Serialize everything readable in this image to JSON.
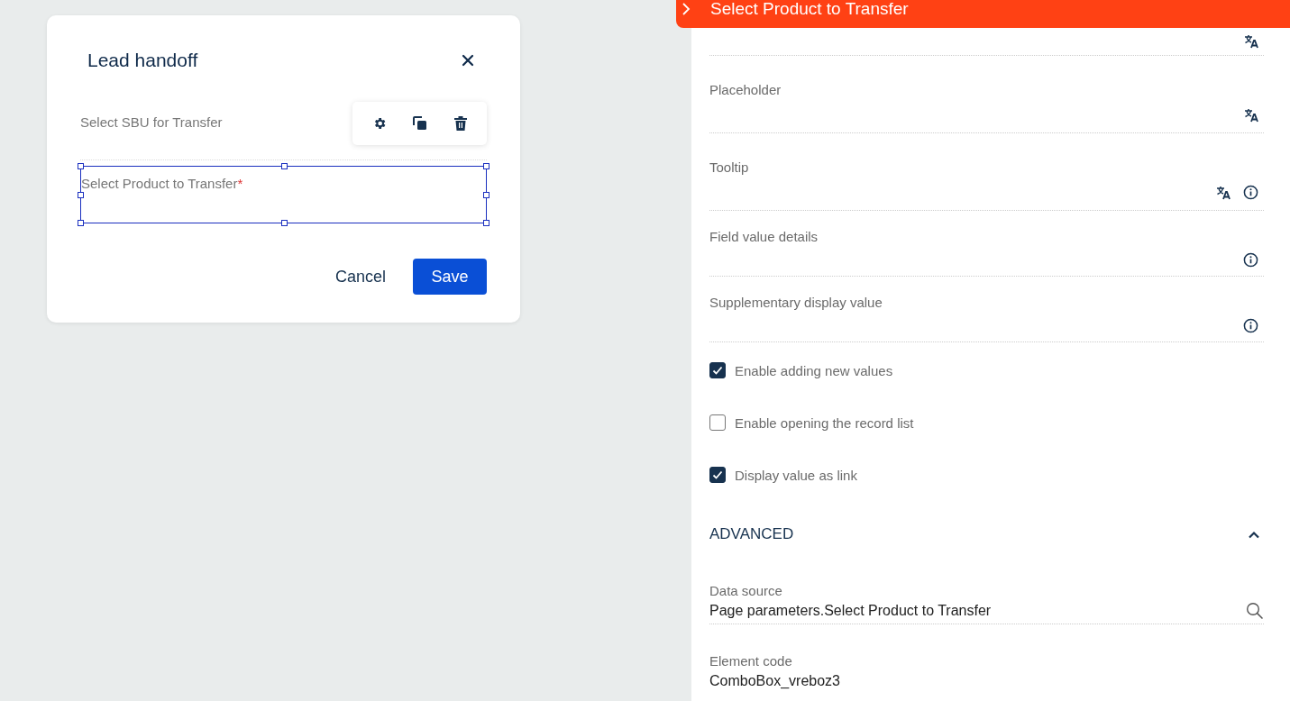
{
  "dialog": {
    "title": "Lead handoff",
    "fields": [
      {
        "label": "Select SBU for Transfer",
        "selected": false
      },
      {
        "label": "Select Product to Transfer",
        "required_mark": "*",
        "selected": true
      }
    ],
    "buttons": [
      {
        "label": "Cancel",
        "kind": "secondary"
      },
      {
        "label": "Save",
        "kind": "primary"
      }
    ]
  },
  "panel": {
    "title": "Select Product to Transfer",
    "properties": [
      {
        "kind": "field",
        "translate": true,
        "info": false
      },
      {
        "kind": "field",
        "label": "Placeholder",
        "translate": true,
        "info": false
      },
      {
        "kind": "field",
        "label": "Tooltip",
        "translate": true,
        "info": true
      },
      {
        "kind": "field",
        "label": "Field value details",
        "translate": false,
        "info": true
      },
      {
        "kind": "field",
        "label": "Supplementary display value",
        "translate": false,
        "info": true
      },
      {
        "kind": "checkbox",
        "label": "Enable adding new values",
        "checked": true
      },
      {
        "kind": "checkbox",
        "label": "Enable opening the record list",
        "checked": false
      },
      {
        "kind": "checkbox",
        "label": "Display value as link",
        "checked": true
      }
    ],
    "advanced": {
      "title": "ADVANCED",
      "expanded": true,
      "fields": [
        {
          "kind": "lookup",
          "label": "Data source",
          "value": "Page parameters.Select Product to Transfer"
        },
        {
          "kind": "text",
          "label": "Element code",
          "value": "ComboBox_vreboz3"
        }
      ]
    }
  }
}
